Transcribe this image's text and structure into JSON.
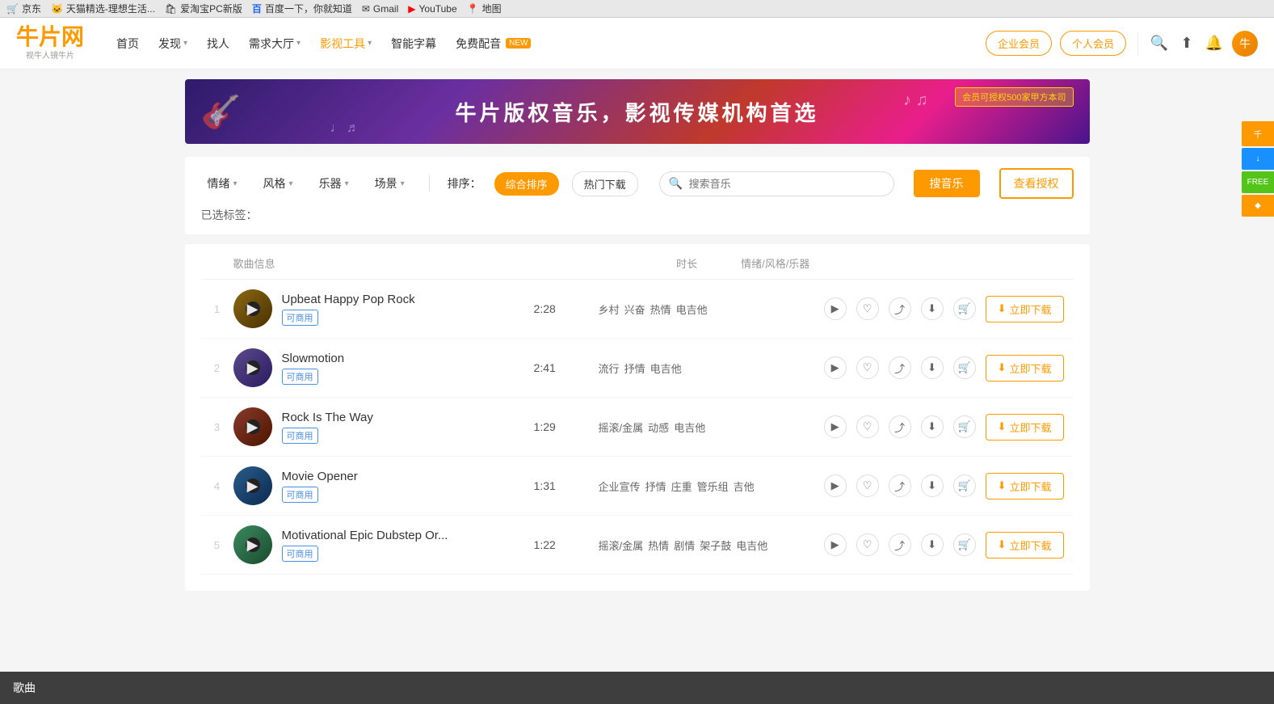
{
  "browser": {
    "tabs": [
      {
        "label": "京东",
        "icon": "🛒"
      },
      {
        "label": "天猫精选-理想生活...",
        "icon": "🐱"
      },
      {
        "label": "爱淘宝PC新版",
        "icon": "🛍"
      },
      {
        "label": "百度一下，你就知道",
        "icon": "🅱"
      },
      {
        "label": "Gmail",
        "icon": "✉"
      },
      {
        "label": "YouTube",
        "icon": "▶"
      },
      {
        "label": "地图",
        "icon": "📍"
      }
    ]
  },
  "nav": {
    "logo_main": "牛片网",
    "logo_sub": "视牛人镜牛片",
    "links": [
      {
        "label": "首页",
        "has_arrow": false,
        "highlight": false
      },
      {
        "label": "发现",
        "has_arrow": true,
        "highlight": false
      },
      {
        "label": "找人",
        "has_arrow": false,
        "highlight": false
      },
      {
        "label": "需求大厅",
        "has_arrow": true,
        "highlight": false
      },
      {
        "label": "影视工具",
        "has_arrow": true,
        "highlight": true
      },
      {
        "label": "智能字幕",
        "has_arrow": false,
        "highlight": false
      },
      {
        "label": "免费配音",
        "has_arrow": false,
        "highlight": false,
        "badge": "NEW"
      }
    ],
    "btn_enterprise": "企业会员",
    "btn_personal": "个人会员"
  },
  "banner": {
    "text": "牛片版权音乐，影视传媒机构首选",
    "sub": "会员可授权500家甲方本司"
  },
  "filter": {
    "emotion_label": "情绪",
    "style_label": "风格",
    "instrument_label": "乐器",
    "scene_label": "场景",
    "sort_label": "排序：",
    "sort_options": [
      {
        "label": "综合排序",
        "active": true
      },
      {
        "label": "热门下载",
        "active": false
      }
    ],
    "search_placeholder": "搜索音乐",
    "btn_search": "搜音乐",
    "btn_auth": "查看授权"
  },
  "selected_tags": {
    "label": "已选标签："
  },
  "table": {
    "col_info": "歌曲信息",
    "col_duration": "时长",
    "col_tags": "情绪/风格/乐器"
  },
  "songs": [
    {
      "id": 1,
      "title": "Upbeat Happy Pop Rock",
      "commercial": "可商用",
      "duration": "2:28",
      "tags": [
        "乡村",
        "兴奋",
        "热情",
        "电吉他"
      ],
      "btn_download": "立即下载"
    },
    {
      "id": 2,
      "title": "Slowmotion",
      "commercial": "可商用",
      "duration": "2:41",
      "tags": [
        "流行",
        "抒情",
        "电吉他"
      ],
      "btn_download": "立即下载"
    },
    {
      "id": 3,
      "title": "Rock Is The Way",
      "commercial": "可商用",
      "duration": "1:29",
      "tags": [
        "摇滚/金属",
        "动感",
        "电吉他"
      ],
      "btn_download": "立即下载"
    },
    {
      "id": 4,
      "title": "Movie Opener",
      "commercial": "可商用",
      "duration": "1:31",
      "tags": [
        "企业宣传",
        "抒情",
        "庄重",
        "管乐组",
        "吉他"
      ],
      "btn_download": "立即下载"
    },
    {
      "id": 5,
      "title": "Motivational Epic Dubstep Or...",
      "commercial": "可商用",
      "duration": "1:22",
      "tags": [
        "摇滚/金属",
        "热情",
        "剧情",
        "架子鼓",
        "电吉他"
      ],
      "btn_download": "立即下载"
    }
  ],
  "sidebar_pills": [
    {
      "label": "千",
      "type": "orange"
    },
    {
      "label": "↓",
      "type": "blue"
    },
    {
      "label": "FREE",
      "type": "free"
    },
    {
      "label": "◆",
      "type": "orange"
    }
  ],
  "bottom_bar": {
    "label": "歌曲"
  }
}
